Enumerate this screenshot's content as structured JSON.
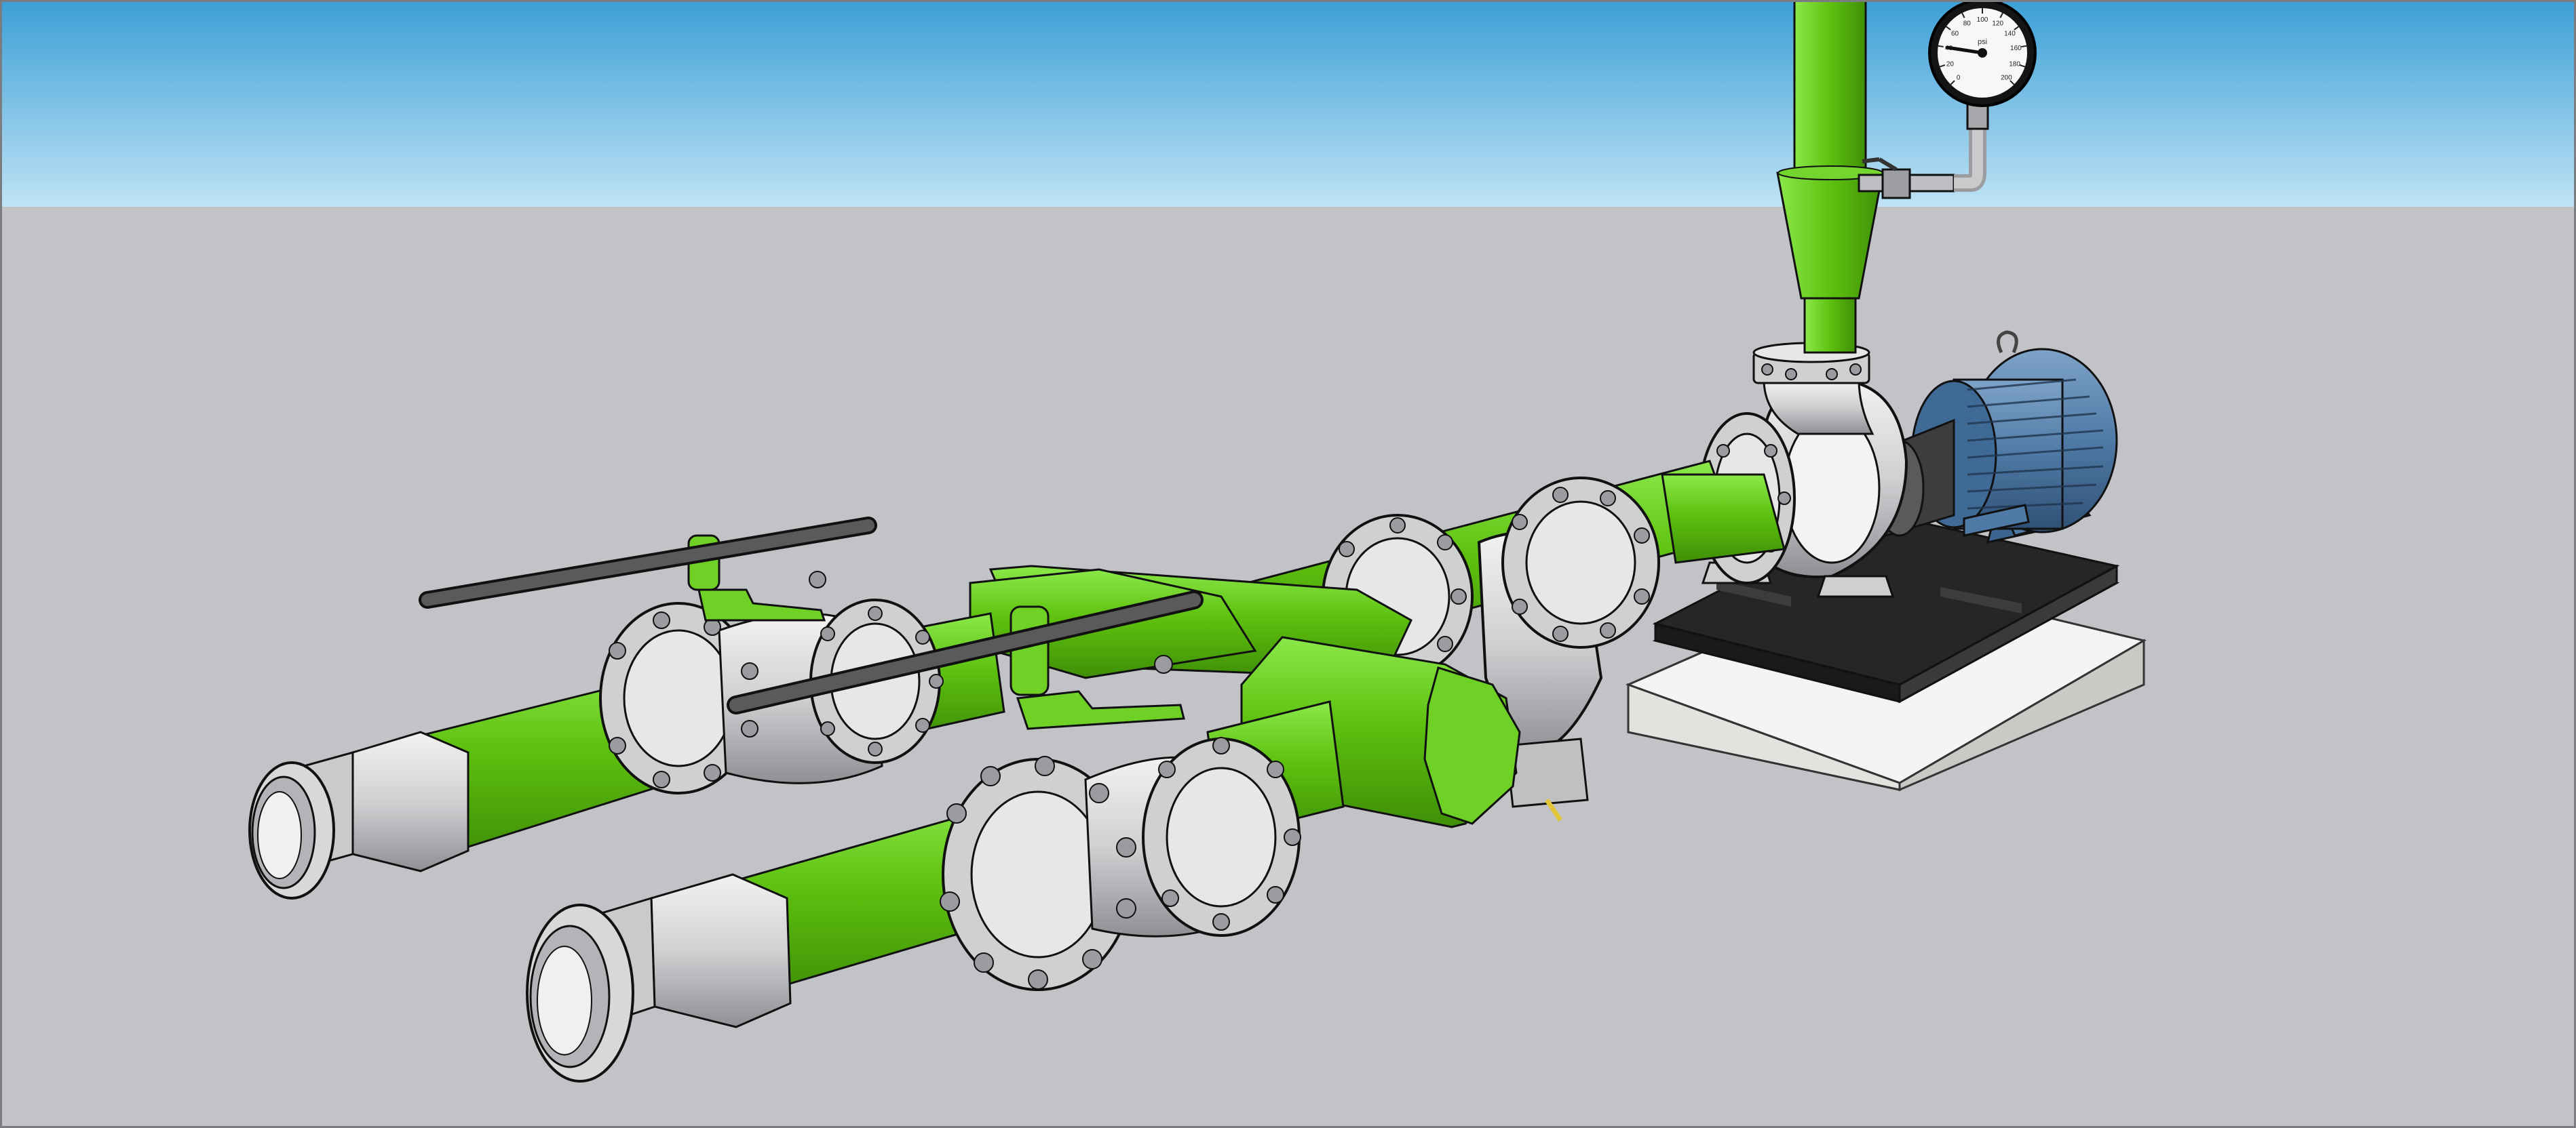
{
  "viewport": {
    "sky_top_color": "#3c9fd6",
    "sky_bottom_color": "#bfe3f5",
    "ground_color": "#c2c3c7",
    "frame_color": "#7a7c80"
  },
  "model": {
    "pipe_color": "#5ec10f",
    "pipe_shade_color": "#3f8f07",
    "steel_color": "#d8d9db",
    "steel_shade_color": "#9a9ca0",
    "motor_color": "#4f7aa6",
    "skid_color": "#1f1f21",
    "concrete_color": "#e6e6e4",
    "handle_color": "#5a5a5c"
  },
  "gauge": {
    "tick_labels": [
      "0",
      "20",
      "40",
      "60",
      "80",
      "100",
      "120",
      "140",
      "160",
      "180",
      "200"
    ],
    "unit": "psi"
  }
}
